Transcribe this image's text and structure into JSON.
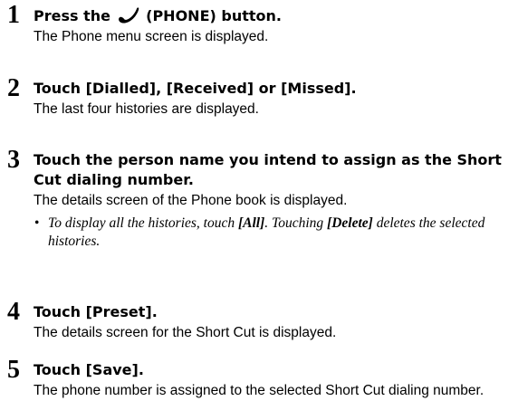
{
  "steps": [
    {
      "number": "1",
      "title_before": "Press the",
      "title_icon": "phone-icon",
      "title_after": "(PHONE) button.",
      "description": "The Phone menu screen is displayed."
    },
    {
      "number": "2",
      "title": "Touch [Dialled], [Received] or [Missed].",
      "description": "The last four histories are displayed."
    },
    {
      "number": "3",
      "title": "Touch the person name you intend to assign as the Short Cut dialing number.",
      "description": "The details screen of the Phone book is displayed.",
      "note": {
        "bullet": "•",
        "part1": "To display all the histories, touch",
        "all_label": "[All]",
        "part2": ". Touching",
        "delete_label": "[Delete]",
        "part3": "deletes the selected histories."
      }
    },
    {
      "number": "4",
      "title": "Touch [Preset].",
      "description": "The details screen for the Short Cut is displayed."
    },
    {
      "number": "5",
      "title": "Touch [Save].",
      "description": "The phone number is assigned to the selected Short Cut dialing number."
    }
  ]
}
